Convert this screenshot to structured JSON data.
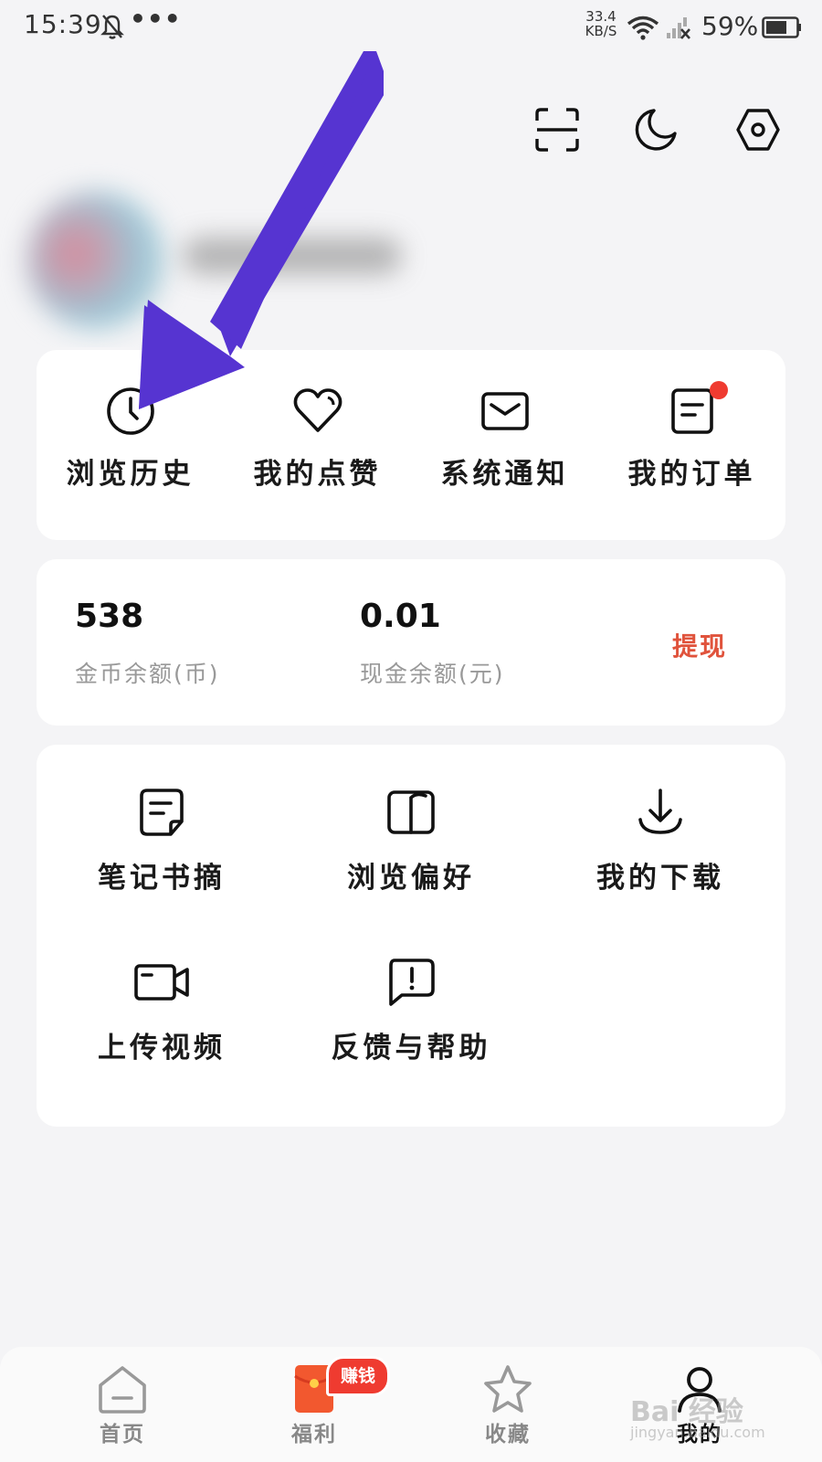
{
  "status_bar": {
    "time": "15:39",
    "more": "•••",
    "net_speed_value": "33.4",
    "net_speed_unit": "KB/S",
    "battery": "59%",
    "icons": [
      "bell-off-icon",
      "wifi-icon",
      "signal-icon",
      "battery-icon"
    ]
  },
  "header_actions": [
    "scan-icon",
    "night-mode-icon",
    "settings-icon"
  ],
  "quick_actions": [
    {
      "label": "浏览历史",
      "icon": "clock-icon"
    },
    {
      "label": "我的点赞",
      "icon": "heart-icon"
    },
    {
      "label": "系统通知",
      "icon": "mail-icon"
    },
    {
      "label": "我的订单",
      "icon": "order-icon",
      "badge": true
    }
  ],
  "balance": {
    "coins_value": "538",
    "coins_label": "金币余额(币)",
    "cash_value": "0.01",
    "cash_label": "现金余额(元)",
    "withdraw_label": "提现"
  },
  "tools": [
    {
      "label": "笔记书摘",
      "icon": "note-icon"
    },
    {
      "label": "浏览偏好",
      "icon": "book-icon"
    },
    {
      "label": "我的下载",
      "icon": "download-icon"
    },
    {
      "label": "上传视频",
      "icon": "video-icon"
    },
    {
      "label": "反馈与帮助",
      "icon": "feedback-icon"
    }
  ],
  "bottom_nav": {
    "items": [
      {
        "label": "首页",
        "icon": "home-icon"
      },
      {
        "label": "福利",
        "icon": "red-envelope-icon"
      },
      {
        "label": "收藏",
        "icon": "star-icon"
      },
      {
        "label": "我的",
        "icon": "user-icon",
        "active": true
      }
    ],
    "earn_badge": "赚钱"
  },
  "watermark": {
    "text": "Bai 经验",
    "sub": "jingyan.baidu.com"
  },
  "colors": {
    "accent_red": "#ef3b30",
    "withdraw": "#e0533c",
    "arrow": "#5634d1"
  }
}
